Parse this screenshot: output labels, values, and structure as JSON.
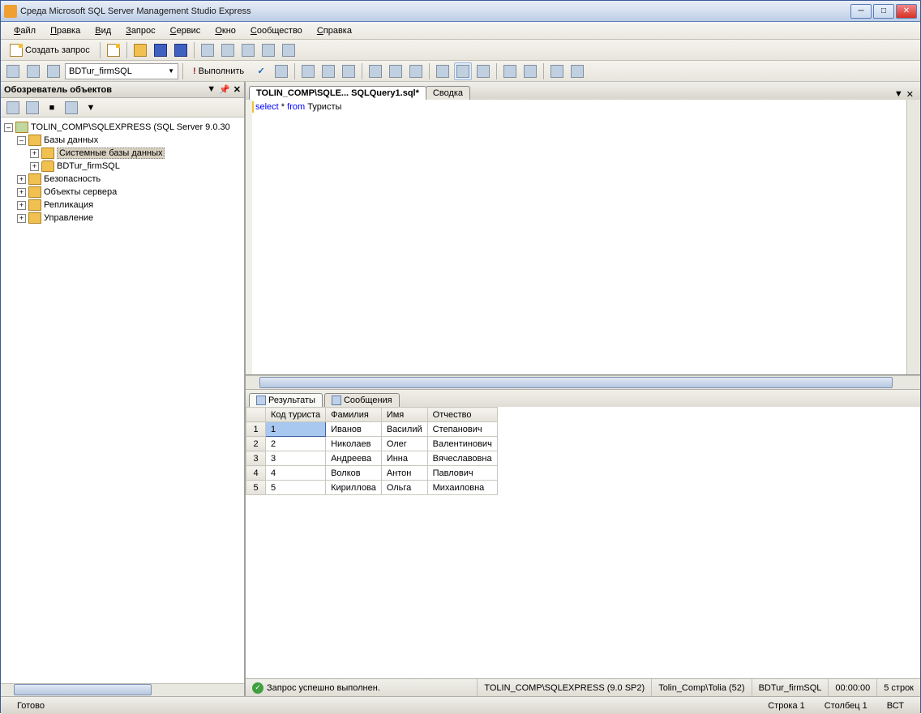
{
  "window": {
    "title": "Среда Microsoft SQL Server Management Studio Express"
  },
  "menu": {
    "file": "Файл",
    "edit": "Правка",
    "view": "Вид",
    "query": "Запрос",
    "tools": "Сервис",
    "window": "Окно",
    "community": "Сообщество",
    "help": "Справка"
  },
  "toolbar1": {
    "new_query": "Создать запрос"
  },
  "toolbar2": {
    "db_combo": "BDTur_firmSQL",
    "execute": "Выполнить"
  },
  "explorer": {
    "title": "Обозреватель объектов",
    "root": "TOLIN_COMP\\SQLEXPRESS (SQL Server 9.0.30",
    "n_databases": "Базы данных",
    "n_sysdb": "Системные базы данных",
    "n_userdb": "BDTur_firmSQL",
    "n_security": "Безопасность",
    "n_serverobj": "Объекты сервера",
    "n_replication": "Репликация",
    "n_management": "Управление"
  },
  "tabs": {
    "active": "TOLIN_COMP\\SQLE... SQLQuery1.sql*",
    "summary": "Сводка"
  },
  "editor": {
    "kw_select": "select",
    "star": " * ",
    "kw_from": "from",
    "rest": " Туристы"
  },
  "results_tabs": {
    "results": "Результаты",
    "messages": "Сообщения"
  },
  "grid": {
    "headers": {
      "id": "Код туриста",
      "lname": "Фамилия",
      "fname": "Имя",
      "mname": "Отчество"
    },
    "rows": [
      {
        "n": "1",
        "id": "1",
        "lname": "Иванов",
        "fname": "Василий",
        "mname": "Степанович"
      },
      {
        "n": "2",
        "id": "2",
        "lname": "Николаев",
        "fname": "Олег",
        "mname": "Валентинович"
      },
      {
        "n": "3",
        "id": "3",
        "lname": "Андреева",
        "fname": "Инна",
        "mname": "Вячеславовна"
      },
      {
        "n": "4",
        "id": "4",
        "lname": "Волков",
        "fname": "Антон",
        "mname": "Павлович"
      },
      {
        "n": "5",
        "id": "5",
        "lname": "Кириллова",
        "fname": "Ольга",
        "mname": "Михаиловна"
      }
    ]
  },
  "results_status": {
    "ok": "Запрос успешно выполнен.",
    "server": "TOLIN_COMP\\SQLEXPRESS (9.0 SP2)",
    "user": "Tolin_Comp\\Tolia (52)",
    "db": "BDTur_firmSQL",
    "time": "00:00:00",
    "rows": "5 строк"
  },
  "statusbar": {
    "ready": "Готово",
    "line": "Строка 1",
    "col": "Столбец 1",
    "ins": "ВСТ"
  }
}
